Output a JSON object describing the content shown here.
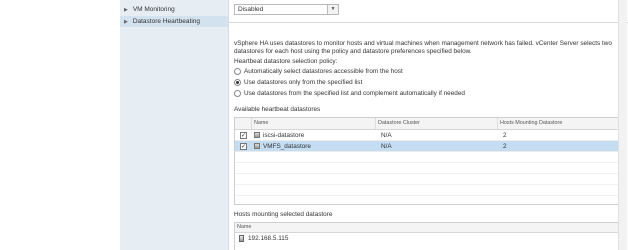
{
  "top_select": {
    "value": "Disabled"
  },
  "nav": {
    "items": [
      {
        "label": "VM Monitoring",
        "caret": "▶"
      },
      {
        "label": "Datastore Heartbeating",
        "caret": "▶"
      }
    ]
  },
  "description": "vSphere HA uses datastores to monitor hosts and virtual machines when management network has failed. vCenter Server selects two datastores for each host using the policy and datastore preferences specified below.",
  "policy": {
    "label": "Heartbeat datastore selection policy:",
    "options": [
      {
        "label": "Automatically select datastores accessible from the host",
        "selected": false
      },
      {
        "label": "Use datastores only from the specified list",
        "selected": true
      },
      {
        "label": "Use datastores from the specified list and complement automatically if needed",
        "selected": false
      }
    ]
  },
  "available": {
    "label": "Available heartbeat datastores",
    "columns": [
      "",
      "Name",
      "Datastore Cluster",
      "Hosts Mounting Datastore"
    ],
    "rows": [
      {
        "checked": true,
        "name": "iscsi-datastore",
        "cluster": "N/A",
        "hosts": "2",
        "selected": false
      },
      {
        "checked": true,
        "name": "VMFS_datastore",
        "cluster": "N/A",
        "hosts": "2",
        "selected": true
      }
    ]
  },
  "hosts_mounting": {
    "label": "Hosts mounting selected datastore",
    "column": "Name",
    "rows": [
      "192.168.5.115"
    ]
  }
}
